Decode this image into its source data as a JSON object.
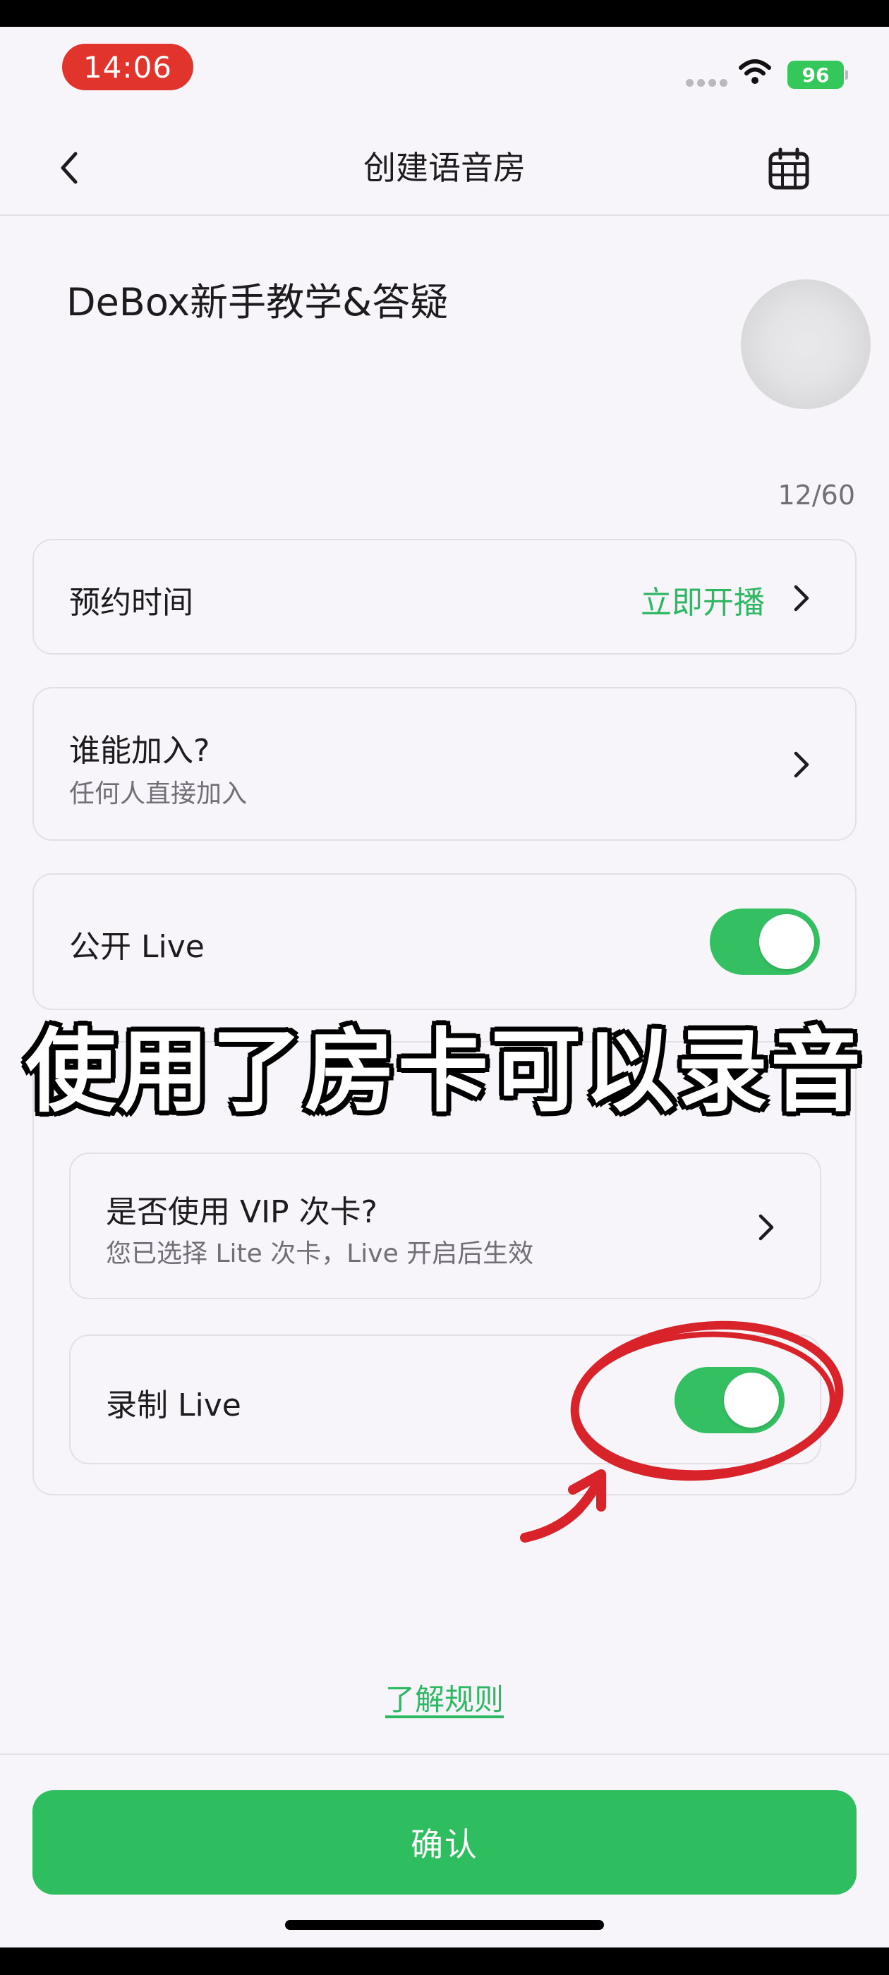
{
  "status_bar": {
    "time": "14:06",
    "battery": "96"
  },
  "nav": {
    "title": "创建语音房"
  },
  "room": {
    "name": "DeBox新手教学&答疑",
    "char_count": "12/60"
  },
  "schedule": {
    "label": "预约时间",
    "value": "立即开播"
  },
  "join": {
    "label": "谁能加入?",
    "sub": "任何人直接加入"
  },
  "public_live": {
    "label": "公开 Live",
    "enabled": true
  },
  "vip_card": {
    "label": "是否使用 VIP 次卡?",
    "sub": "您已选择 Lite 次卡，Live 开启后生效"
  },
  "record_live": {
    "label": "录制 Live",
    "enabled": true
  },
  "overlay": {
    "caption": "使用了房卡可以录音"
  },
  "footer": {
    "rules_link": "了解规则",
    "confirm": "确认"
  },
  "colors": {
    "accent": "#2ebd5f",
    "annotation": "#d8232a",
    "time_pill": "#e0342c"
  }
}
